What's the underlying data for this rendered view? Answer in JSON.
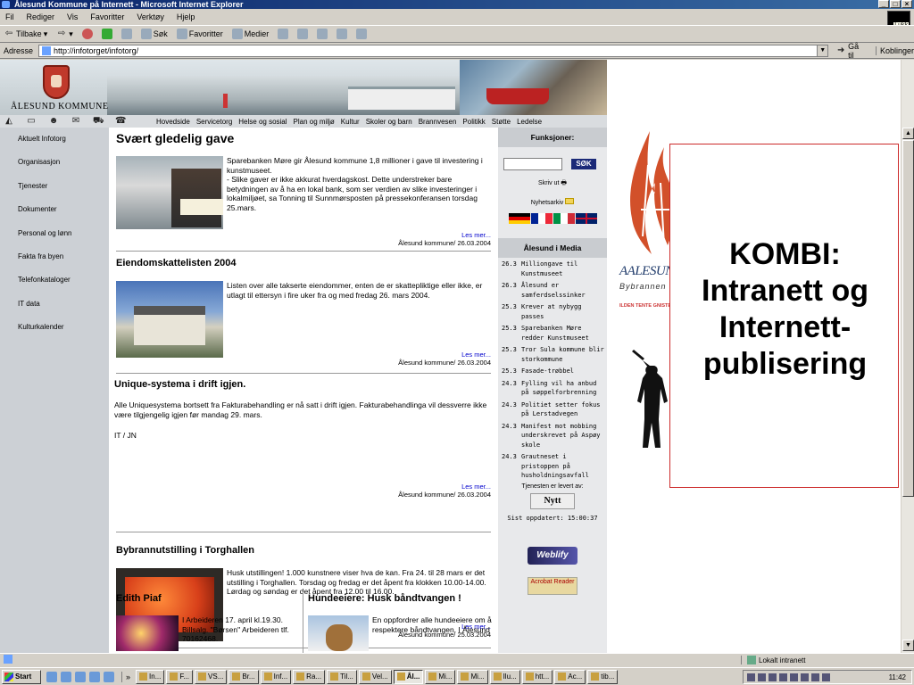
{
  "window": {
    "title": "Ålesund Kommune på Internett - Microsoft Internet Explorer",
    "min": "_",
    "max": "□",
    "close": "×"
  },
  "menu": [
    "Fil",
    "Rediger",
    "Vis",
    "Favoritter",
    "Verktøy",
    "Hjelp"
  ],
  "ie_logo_label": "Lukk",
  "toolbar": {
    "back": "Tilbake",
    "search": "Søk",
    "favorites": "Favoritter",
    "media": "Medier"
  },
  "address": {
    "label": "Adresse",
    "url": "http://infotorget/infotorg/",
    "go": "Gå til",
    "links": "Koblinger"
  },
  "site": {
    "kommune": "ÅLESUND KOMMUNE",
    "nav_links": [
      "Hovedside",
      "Servicetorg",
      "Helse og sosial",
      "Plan og miljø",
      "Kultur",
      "Skoler og barn",
      "Brannvesen",
      "Politikk",
      "Støtte",
      "Ledelse"
    ],
    "left_menu": [
      "Aktuelt Infotorg",
      "Organisasjon",
      "Tjenester",
      "Dokumenter",
      "Personal og lønn",
      "Fakta fra byen",
      "Telefonkataloger",
      "IT data",
      "Kulturkalender"
    ],
    "articles": [
      {
        "title": "Svært gledelig gave",
        "text": "Sparebanken Møre gir Ålesund kommune 1,8 millioner i gave til investering i kunstmuseet.\n- Slike gaver er ikke akkurat hverdagskost. Dette understreker bare betydningen av å ha en lokal bank, som ser verdien av slike investeringer i lokalmiljøet, sa Tonning til Sunnmørsposten på pressekonferansen torsdag 25.mars.",
        "more": "Les mer...",
        "source": "Ålesund kommune/ 26.03.2004"
      },
      {
        "title": "Eiendomskattelisten 2004",
        "text": "Listen over alle takserte eiendommer, enten de er skattepliktige eller ikke, er utlagt til ettersyn i fire uker fra og med fredag 26. mars 2004.",
        "more": "Les mer...",
        "source": "Ålesund kommune/ 26.03.2004"
      },
      {
        "title": "Unique-systema i drift igjen.",
        "text": "Alle Uniquesystema bortsett fra Fakturabehandling er nå satt i drift igjen. Fakturabehandlinga vil dessverre ikke være tilgjengelig igjen før mandag 29. mars.",
        "sign": "IT / JN",
        "more": "Les mer...",
        "source": "Ålesund kommune/ 26.03.2004"
      },
      {
        "title": "Bybrannutstilling i Torghallen",
        "text": "Husk utstillingen! 1.000 kunstnere viser hva de kan. Fra 24. til 28 mars er det utstilling i Torghallen. Torsdag og fredag er det åpent fra klokken 10.00-14.00. Lørdag og søndag er det åpent fra 12.00 til 16.00.",
        "more": "Les mer...",
        "source": "Ålesund kommune/ 25.03.2004"
      }
    ],
    "bottom_left": {
      "title": "Edith Piaf",
      "text": "I Arbeideren 17. april kl.19.30. Billsalg. \"Børsen\" Arbeideren tlf. 70162468."
    },
    "bottom_right": {
      "title": "Hundeeiere: Husk båndtvangen !",
      "text": "En oppfordrer alle hundeeiere om å respektere båndtvangen. I Ålesund"
    },
    "functions": {
      "title": "Funksjoner:",
      "search_btn": "SØK",
      "print": "Skriv ut",
      "archive": "Nyhetsarkiv"
    },
    "media": {
      "title": "Ålesund i Media",
      "items": [
        {
          "date": "26.3",
          "text": "Milliongave til Kunstmuseet"
        },
        {
          "date": "26.3",
          "text": "Ålesund er samferdselssinker"
        },
        {
          "date": "25.3",
          "text": "Krever at nybygg passes"
        },
        {
          "date": "25.3",
          "text": "Sparebanken Møre redder Kunstmuseet"
        },
        {
          "date": "25.3",
          "text": "Tror Sula kommune blir storkommune"
        },
        {
          "date": "25.3",
          "text": "Fasade-trøbbel"
        },
        {
          "date": "24.3",
          "text": "Fylling vil ha anbud på søppelforbrenning"
        },
        {
          "date": "24.3",
          "text": "Politiet setter fokus på Lerstadvegen"
        },
        {
          "date": "24.3",
          "text": "Manifest mot mobbing underskrevet på Aspøy skole"
        },
        {
          "date": "24.3",
          "text": "Grautneset i pristoppen på husholdningsavfall"
        }
      ],
      "delivered": "Tjenesten er levert av:",
      "logo": "Nytt",
      "updated": "Sist oppdatert: 15:00:37"
    },
    "weblify": "Weblify",
    "acrobat": "Acrobat Reader"
  },
  "slide": {
    "aalesund": "AALESUND",
    "bybrann": "Bybrannen",
    "bybrann_sub": "ILDEN TENTE GNISTEN",
    "lines": [
      "KOMBI:",
      "Intranett og",
      "Internett-",
      "publisering"
    ]
  },
  "status": {
    "left": "",
    "zone": "Lokalt intranett"
  },
  "taskbar": {
    "start": "Start",
    "buttons": [
      "In...",
      "F...",
      "VS...",
      "Br...",
      "Inf...",
      "Ra...",
      "Til...",
      "Vel...",
      "Ål...",
      "Mi...",
      "Mi...",
      "Ilu...",
      "htt...",
      "Ac...",
      "tib..."
    ],
    "active_index": 8,
    "clock": "11:42"
  }
}
